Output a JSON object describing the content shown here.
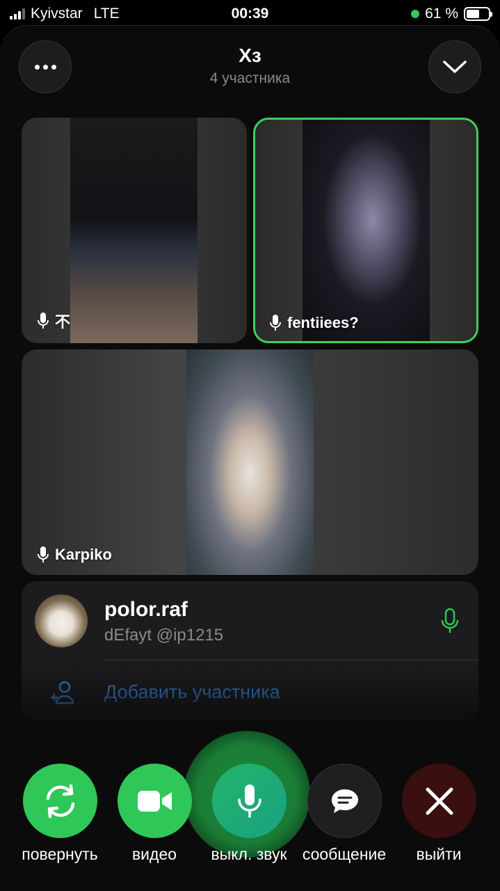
{
  "status_bar": {
    "carrier": "Kyivstar",
    "network": "LTE",
    "time": "00:39",
    "battery_percent": "61 %",
    "battery_level": 0.61
  },
  "header": {
    "title": "Хз",
    "subtitle": "4 участника"
  },
  "tiles": [
    {
      "name": "不",
      "speaking": false
    },
    {
      "name": "fentiiees?",
      "speaking": true
    },
    {
      "name": "Karpiko",
      "speaking": false
    }
  ],
  "participants": [
    {
      "name": "polor.raf",
      "subtitle": "dEfayt @ip1215"
    }
  ],
  "add_participant_label": "Добавить участника",
  "controls": {
    "flip": "повернуть",
    "video": "видео",
    "mute": "выкл. звук",
    "message": "сообщение",
    "leave": "выйти"
  },
  "colors": {
    "accent_green": "#2fc758",
    "speaking_border": "#3ecf5e",
    "link_blue": "#3b8ee8",
    "leave_red_bg": "#3a0f10"
  }
}
